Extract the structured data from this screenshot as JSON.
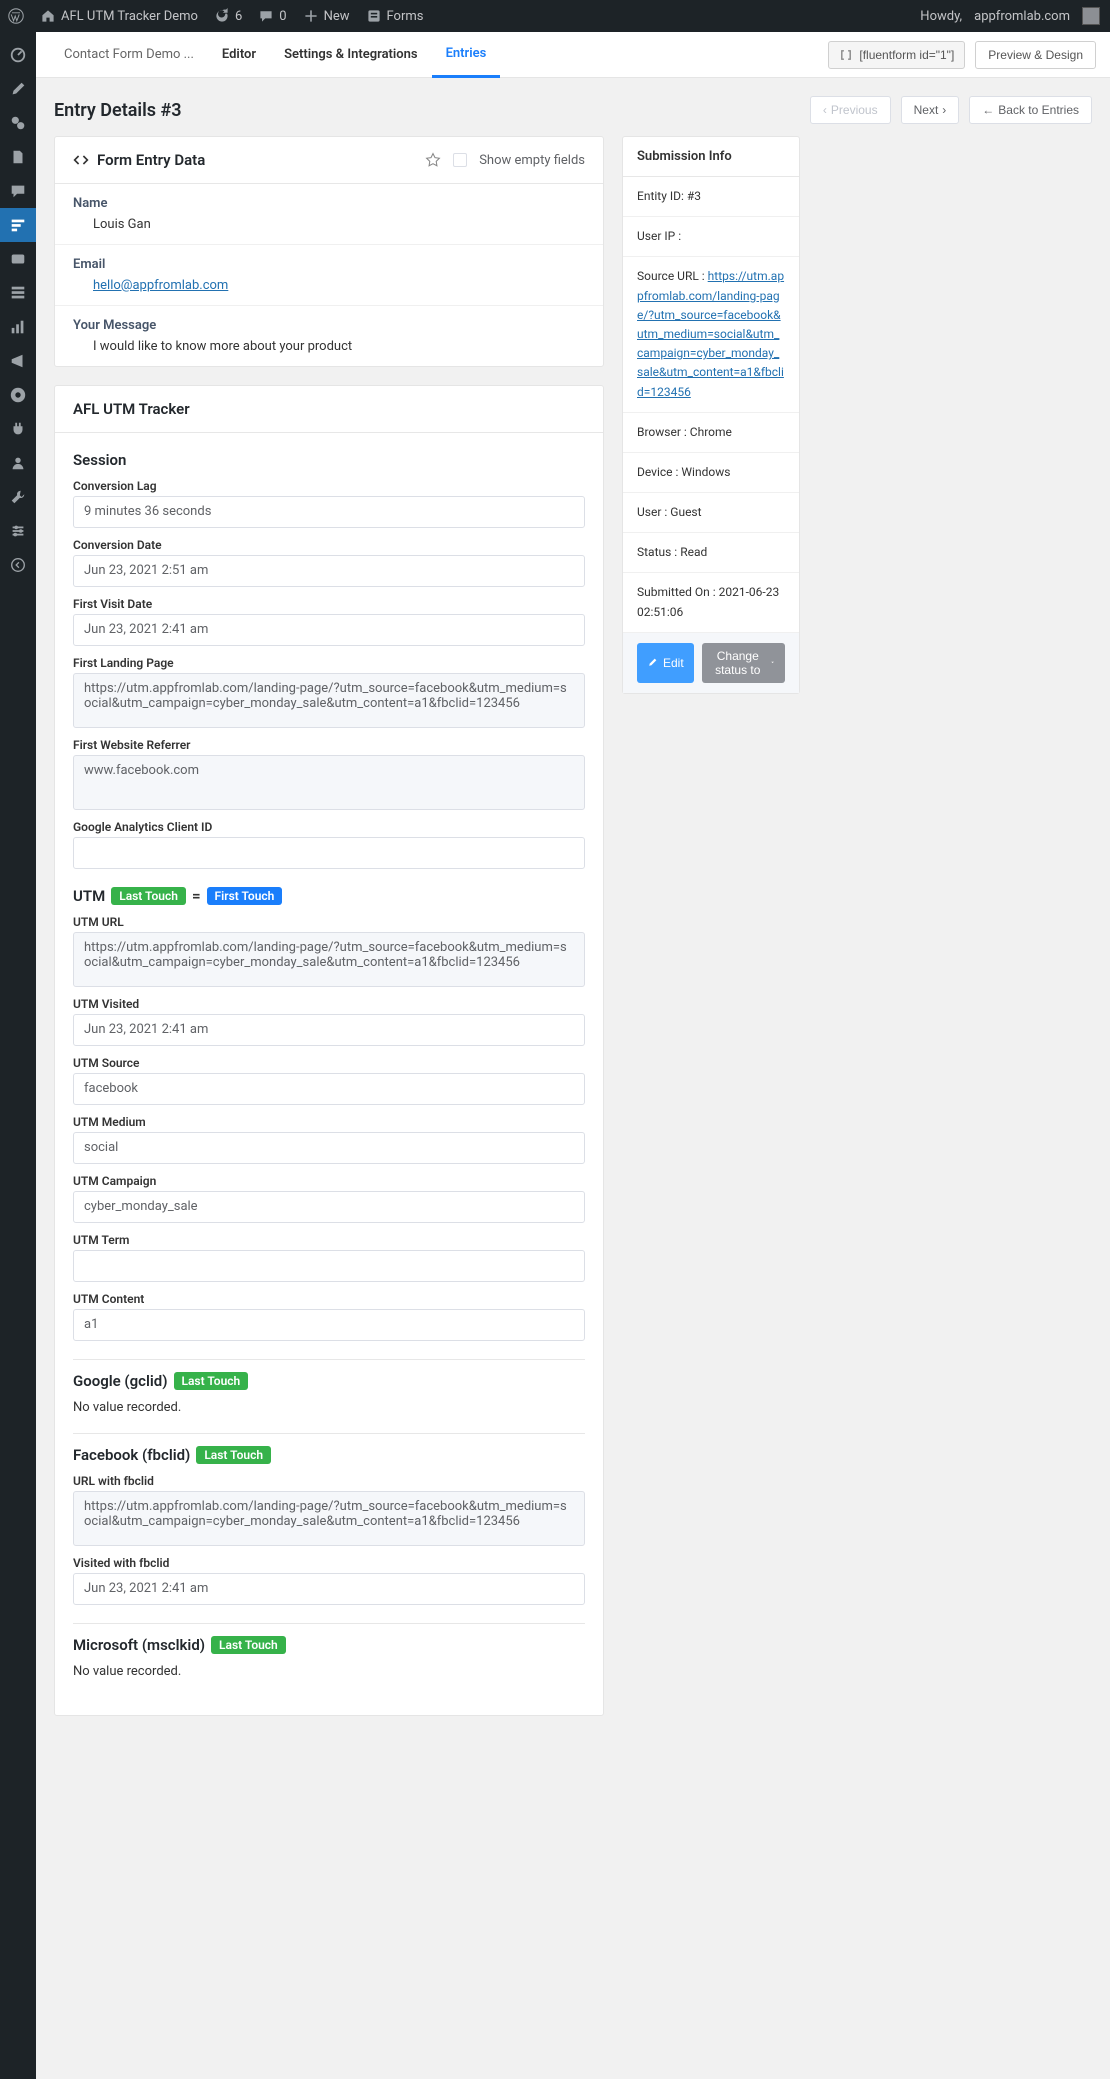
{
  "adminbar": {
    "site": "AFL UTM Tracker Demo",
    "updates": "6",
    "comments": "0",
    "new": "New",
    "forms": "Forms",
    "howdy": "Howdy,",
    "domain": "appfromlab.com"
  },
  "tabs": {
    "form_name": "Contact Form Demo ...",
    "editor": "Editor",
    "settings": "Settings & Integrations",
    "entries": "Entries",
    "shortcode": "[fluentform id=\"1\"]",
    "preview": "Preview & Design"
  },
  "page": {
    "title": "Entry Details #3",
    "prev": "Previous",
    "next": "Next",
    "back": "Back to Entries"
  },
  "form_entry": {
    "header": "Form Entry Data",
    "show_empty": "Show empty fields",
    "name_label": "Name",
    "name_value": "Louis Gan",
    "email_label": "Email",
    "email_value": "hello@appfromlab.com",
    "message_label": "Your Message",
    "message_value": "I would like to know more about your product"
  },
  "tracker": {
    "title": "AFL UTM Tracker",
    "session": {
      "title": "Session",
      "conv_lag_label": "Conversion Lag",
      "conv_lag": "9 minutes 36 seconds",
      "conv_date_label": "Conversion Date",
      "conv_date": "Jun 23, 2021 2:51 am",
      "first_visit_label": "First Visit Date",
      "first_visit": "Jun 23, 2021 2:41 am",
      "first_landing_label": "First Landing Page",
      "first_landing": "https://utm.appfromlab.com/landing-page/?utm_source=facebook&utm_medium=social&utm_campaign=cyber_monday_sale&utm_content=a1&fbclid=123456",
      "first_referrer_label": "First Website Referrer",
      "first_referrer": "www.facebook.com",
      "ga_client_label": "Google Analytics Client ID",
      "ga_client": ""
    },
    "utm": {
      "title": "UTM",
      "last_touch": "Last Touch",
      "first_touch": "First Touch",
      "url_label": "UTM URL",
      "url": "https://utm.appfromlab.com/landing-page/?utm_source=facebook&utm_medium=social&utm_campaign=cyber_monday_sale&utm_content=a1&fbclid=123456",
      "visited_label": "UTM Visited",
      "visited": "Jun 23, 2021 2:41 am",
      "source_label": "UTM Source",
      "source": "facebook",
      "medium_label": "UTM Medium",
      "medium": "social",
      "campaign_label": "UTM Campaign",
      "campaign": "cyber_monday_sale",
      "term_label": "UTM Term",
      "term": "",
      "content_label": "UTM Content",
      "content": "a1"
    },
    "google": {
      "title": "Google (gclid)",
      "badge": "Last Touch",
      "novalue": "No value recorded."
    },
    "facebook": {
      "title": "Facebook (fbclid)",
      "badge": "Last Touch",
      "url_label": "URL with fbclid",
      "url": "https://utm.appfromlab.com/landing-page/?utm_source=facebook&utm_medium=social&utm_campaign=cyber_monday_sale&utm_content=a1&fbclid=123456",
      "visited_label": "Visited with fbclid",
      "visited": "Jun 23, 2021 2:41 am"
    },
    "microsoft": {
      "title": "Microsoft (msclkid)",
      "badge": "Last Touch",
      "novalue": "No value recorded."
    }
  },
  "submission": {
    "header": "Submission Info",
    "entity_id_label": "Entity ID:",
    "entity_id": "#3",
    "user_ip_label": "User IP :",
    "user_ip": "",
    "source_label": "Source URL :",
    "source_url": "https://utm.appfromlab.com/landing-page/?utm_source=facebook&utm_medium=social&utm_campaign=cyber_monday_sale&utm_content=a1&fbclid=123456",
    "browser_label": "Browser :",
    "browser": "Chrome",
    "device_label": "Device :",
    "device": "Windows",
    "user_label": "User :",
    "user": "Guest",
    "status_label": "Status :",
    "status": "Read",
    "submitted_label": "Submitted On :",
    "submitted": "2021-06-23 02:51:06",
    "edit": "Edit",
    "change_status": "Change status to"
  }
}
